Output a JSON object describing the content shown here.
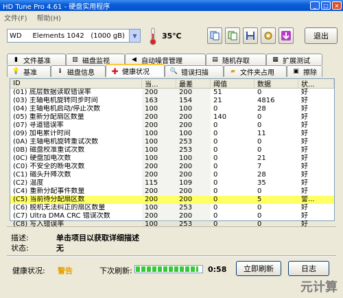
{
  "window": {
    "title": "HD Tune Pro 4.61 - 硬盘实用程序"
  },
  "menu": [
    "文件(F)",
    "帮助(H)"
  ],
  "toolbar": {
    "drive": "WD     Elements 1042   (1000 gB)",
    "temperature": "35℃",
    "exit_label": "退出"
  },
  "tabs_top": [
    {
      "label": "文件基准",
      "icon": "file-benchmark-icon"
    },
    {
      "label": "磁盘监视",
      "icon": "disk-monitor-icon"
    },
    {
      "label": "自动噪音管理",
      "icon": "speaker-icon"
    },
    {
      "label": "随机存取",
      "icon": "random-access-icon"
    },
    {
      "label": "扩展测试",
      "icon": "extra-tests-icon"
    }
  ],
  "tabs_bottom": [
    {
      "label": "基准",
      "icon": "benchmark-icon",
      "active": false
    },
    {
      "label": "磁盘信息",
      "icon": "info-icon",
      "active": false
    },
    {
      "label": "健康状况",
      "icon": "health-cross-icon",
      "active": true
    },
    {
      "label": "错误扫描",
      "icon": "error-scan-icon",
      "active": false
    },
    {
      "label": "文件夹占用",
      "icon": "folder-icon",
      "active": false
    },
    {
      "label": "擦除",
      "icon": "erase-icon",
      "active": false
    }
  ],
  "table": {
    "headers": [
      "ID",
      "当...",
      "最差",
      "阈值",
      "数据",
      "状..."
    ],
    "rows": [
      [
        "(01) 底层数据读取错误率",
        "200",
        "200",
        "51",
        "0",
        "好"
      ],
      [
        "(03) 主轴电机旋转同步时间",
        "163",
        "154",
        "21",
        "4816",
        "好"
      ],
      [
        "(04) 主轴电机启动/停止次数",
        "100",
        "100",
        "0",
        "28",
        "好"
      ],
      [
        "(05) 重新分配扇区数量",
        "200",
        "200",
        "140",
        "0",
        "好"
      ],
      [
        "(07) 寻道错误率",
        "200",
        "200",
        "0",
        "0",
        "好"
      ],
      [
        "(09) 加电累计时间",
        "100",
        "100",
        "0",
        "11",
        "好"
      ],
      [
        "(0A) 主轴电机旋转重试次数",
        "100",
        "253",
        "0",
        "0",
        "好"
      ],
      [
        "(0B) 磁盘校准重试次数",
        "100",
        "253",
        "0",
        "0",
        "好"
      ],
      [
        "(0C) 硬盘加电次数",
        "100",
        "100",
        "0",
        "21",
        "好"
      ],
      [
        "(C0) 不安全的断电次数",
        "200",
        "200",
        "0",
        "7",
        "好"
      ],
      [
        "(C1) 磁头升降次数",
        "200",
        "200",
        "0",
        "28",
        "好"
      ],
      [
        "(C2) 温度",
        "115",
        "109",
        "0",
        "35",
        "好"
      ],
      [
        "(C4) 重新分配事件数量",
        "200",
        "200",
        "0",
        "0",
        "好"
      ],
      [
        "(C5) 当前待分配扇区数",
        "200",
        "200",
        "0",
        "5",
        "警..."
      ],
      [
        "(C6) 脱机无法纠正的扇区数量",
        "100",
        "253",
        "0",
        "0",
        "好"
      ],
      [
        "(C7) Ultra DMA CRC 错误次数",
        "200",
        "200",
        "0",
        "0",
        "好"
      ],
      [
        "(C8) 写入错误率",
        "100",
        "253",
        "0",
        "0",
        "好"
      ]
    ],
    "highlight_row": 13
  },
  "details": {
    "desc_label": "描述:",
    "desc_value": "单击项目以获取详细描述",
    "status_label": "状态:",
    "status_value": "无"
  },
  "footer": {
    "health_label": "健康状况:",
    "health_value": "警告",
    "next_refresh_label": "下次刷新:",
    "progress": 0.95,
    "countdown": "0:58",
    "refresh_button": "立即刷新",
    "log_button": "日志"
  },
  "watermark": "元计算",
  "colors": {
    "highlight": "#ffff66",
    "warning": "#e6a100",
    "title_bar": "#0a5fd8"
  }
}
